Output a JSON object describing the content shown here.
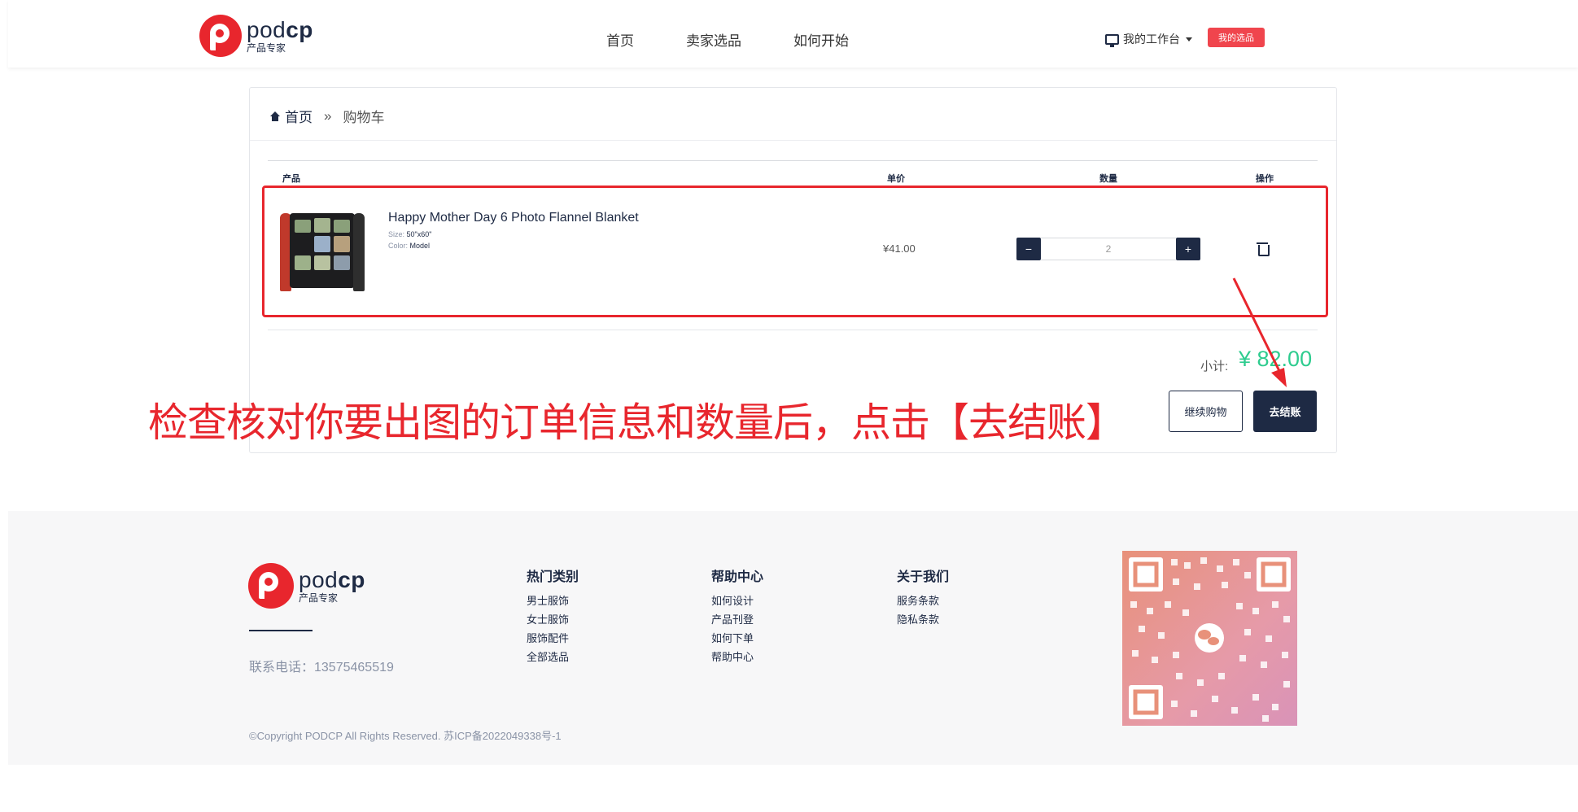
{
  "header": {
    "logo": {
      "word_regular": "pod",
      "word_bold": "cp",
      "tagline": "产品专家"
    },
    "nav": [
      "首页",
      "卖家选品",
      "如何开始"
    ],
    "workbench_label": "我的工作台",
    "my_picks_label": "我的选品"
  },
  "breadcrumb": {
    "home": "首页",
    "separator": "»",
    "current": "购物车"
  },
  "table": {
    "headers": {
      "product": "产品",
      "unit_price": "单价",
      "quantity": "数量",
      "action": "操作"
    },
    "rows": [
      {
        "name": "Happy Mother Day 6 Photo Flannel Blanket",
        "size_label": "Size:",
        "size_value": "50\"x60\"",
        "color_label": "Color:",
        "color_value": "Model",
        "price": "¥41.00",
        "quantity": "2",
        "minus": "−",
        "plus": "+"
      }
    ]
  },
  "summary": {
    "subtotal_label": "小计:",
    "subtotal_value": "¥ 82.00",
    "continue_label": "继续购物",
    "checkout_label": "去结账"
  },
  "annotation": {
    "text": "检查核对你要出图的订单信息和数量后，点击【去结账】",
    "color": "#e8262d"
  },
  "footer": {
    "logo": {
      "word_regular": "pod",
      "word_bold": "cp",
      "tagline": "产品专家"
    },
    "contact": "联系电话：13575465519",
    "copyright": "©Copyright PODCP All Rights Reserved. 苏ICP备2022049338号-1",
    "columns": [
      {
        "title": "热门类别",
        "items": [
          "男士服饰",
          "女士服饰",
          "服饰配件",
          "全部选品"
        ]
      },
      {
        "title": "帮助中心",
        "items": [
          "如何设计",
          "产品刊登",
          "如何下单",
          "帮助中心"
        ]
      },
      {
        "title": "关于我们",
        "items": [
          "服务条款",
          "隐私条款"
        ]
      }
    ]
  },
  "colors": {
    "brand_red": "#e8262d",
    "navy": "#1e2a44",
    "subtotal_green": "#2ecc8f"
  }
}
